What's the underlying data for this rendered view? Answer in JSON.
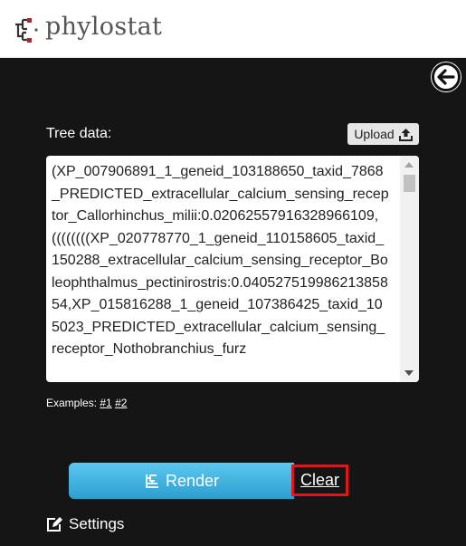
{
  "header": {
    "logo_text": "phylostat",
    "logo_icon": "tree-logo-icon"
  },
  "panel": {
    "back_icon": "arrow-left-circle-icon",
    "tree_label": "Tree data:",
    "upload_label": "Upload",
    "upload_icon": "upload-icon",
    "tree_value": "(XP_007906891_1_geneid_103188650_taxid_7868_PREDICTED_extracellular_calcium_sensing_receptor_Callorhinchus_milii:0.02062557916328966109, ((((((((XP_020778770_1_geneid_110158605_taxid_150288_extracellular_calcium_sensing_receptor_Boleophthalmus_pectinirostris:0.04052751998621385854,XP_015816288_1_geneid_107386425_taxid_105023_PREDICTED_extracellular_calcium_sensing_receptor_Nothobranchius_furz",
    "examples_label": "Examples:",
    "example_links": [
      "#1",
      "#2"
    ],
    "render_label": "Render",
    "render_icon": "tree-icon",
    "clear_label": "Clear",
    "settings_label": "Settings",
    "settings_icon": "edit-icon"
  },
  "colors": {
    "panel_bg": "#151515",
    "render_button": "#3db4e0",
    "highlight": "#e3151a"
  }
}
